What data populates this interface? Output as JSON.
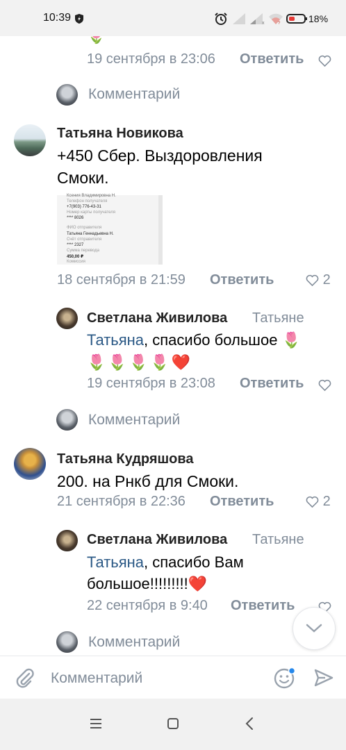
{
  "status_bar": {
    "time": "10:39",
    "battery": "18%"
  },
  "feed": {
    "top_partial": {
      "date": "19 сентября в 23:06",
      "reply_label": "Ответить"
    },
    "comment_prompt_1": "Комментарий",
    "comment_1": {
      "author": "Татьяна Новикова",
      "text_line_1": "+450 Сбер. Выздоровления",
      "text_line_2": "Смоки.",
      "receipt": {
        "line_1": "Ксения Владимировна Н.",
        "line_2": "Телефон получателя",
        "line_3": "+7(903) 776-43-31",
        "line_4": "Номер карты получателя",
        "line_5": "**** 8026",
        "line_6": "ФИО отправителя",
        "line_7": "Татьяна Геннадьевна Н.",
        "line_8": "Счёт отправителя",
        "line_9": "**** 2327",
        "line_10": "Сумма перевода",
        "line_11": "450,00 ₽",
        "line_12": "Комиссия"
      },
      "date": "18 сентября в 21:59",
      "reply_label": "Ответить",
      "likes": "2"
    },
    "reply_1": {
      "author": "Светлана Живилова",
      "reply_to": "Татьяне",
      "mention": "Татьяна",
      "text_line_1": ", спасибо большое 🌷",
      "text_line_2": "🌷🌷🌷🌷❤️",
      "date": "19 сентября в 23:08",
      "reply_label": "Ответить"
    },
    "comment_prompt_2": "Комментарий",
    "comment_2": {
      "author": "Татьяна Кудряшова",
      "text": "200. на Рнкб для Смоки.",
      "date": "21 сентября в 22:36",
      "reply_label": "Ответить",
      "likes": "2"
    },
    "reply_2": {
      "author": "Светлана Живилова",
      "reply_to": "Татьяне",
      "mention": "Татьяна",
      "text_line_1": ", спасибо Вам",
      "text_line_2": "большое!!!!!!!!!❤️",
      "date": "22 сентября в 9:40",
      "reply_label": "Ответить"
    },
    "comment_prompt_3": "Комментарий"
  },
  "composer": {
    "placeholder": "Комментарий"
  },
  "colors": {
    "secondary_text": "#818c99",
    "link": "#2a5885",
    "accent": "#2688eb"
  }
}
